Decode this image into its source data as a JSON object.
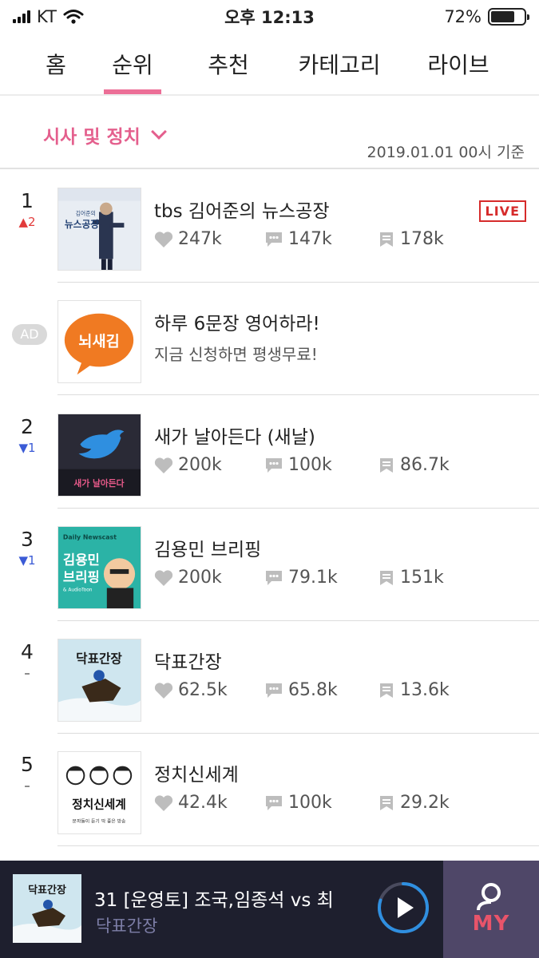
{
  "status_bar": {
    "carrier": "KT",
    "time": "오후 12:13",
    "battery": "72%",
    "battery_level": 0.72
  },
  "tabs": [
    {
      "label": "홈",
      "active": false
    },
    {
      "label": "순위",
      "active": true
    },
    {
      "label": "추천",
      "active": false
    },
    {
      "label": "카테고리",
      "active": false
    },
    {
      "label": "라이브",
      "active": false
    }
  ],
  "category": {
    "label": "시사 및 정치",
    "reference_date": "2019.01.01 00시 기준"
  },
  "ad": {
    "badge": "AD",
    "title": "하루 6문장 영어하라!",
    "subtitle": "지금 신청하면 평생무료!",
    "logo_text": "뇌새김"
  },
  "rankings": [
    {
      "rank": "1",
      "change": "2",
      "direction": "up",
      "title": "tbs 김어준의 뉴스공장",
      "likes": "247k",
      "comments": "147k",
      "episodes": "178k",
      "live": "LIVE",
      "thumb_text": "뉴스공장",
      "thumb_sub": "김어준의"
    },
    {
      "rank": "2",
      "change": "1",
      "direction": "down",
      "title": "새가 날아든다 (새날)",
      "likes": "200k",
      "comments": "100k",
      "episodes": "86.7k",
      "thumb_text": "새가 날아든다"
    },
    {
      "rank": "3",
      "change": "1",
      "direction": "down",
      "title": "김용민 브리핑",
      "likes": "200k",
      "comments": "79.1k",
      "episodes": "151k",
      "thumb_text": "김용민",
      "thumb_text2": "브리핑",
      "thumb_sub": "Daily Newscast",
      "thumb_sub2": "& AudioToon"
    },
    {
      "rank": "4",
      "change": "",
      "direction": "same",
      "title": "닥표간장",
      "likes": "62.5k",
      "comments": "65.8k",
      "episodes": "13.6k",
      "thumb_text": "닥표간장"
    },
    {
      "rank": "5",
      "change": "",
      "direction": "same",
      "title": "정치신세계",
      "likes": "42.4k",
      "comments": "100k",
      "episodes": "29.2k",
      "thumb_text": "정치신세계",
      "thumb_sub": "문파들이 듣기 딱 좋은 방송"
    }
  ],
  "player": {
    "title": "31 [운영토] 조국,임종석 vs 최",
    "subtitle": "닥표간장",
    "progress": 0.8,
    "my_label": "MY",
    "thumb_text": "닥표간장"
  },
  "colors": {
    "accent": "#ec6f97",
    "live": "#d62b2b",
    "up": "#e23b3b",
    "down": "#3b5bd6",
    "player_bg": "#1e1f2e",
    "my_bg": "#4f4768"
  }
}
